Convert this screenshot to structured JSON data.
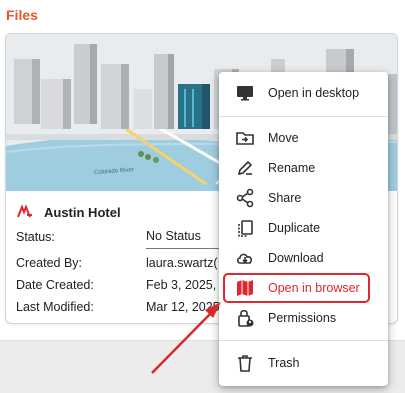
{
  "section": {
    "title": "Files"
  },
  "card": {
    "title": "Austin Hotel",
    "fields": [
      {
        "label": "Status:",
        "value": "No Status"
      },
      {
        "label": "Created By:",
        "value": "laura.swartz("
      },
      {
        "label": "Date Created:",
        "value": "Feb 3, 2025, 1"
      },
      {
        "label": "Last Modified:",
        "value": "Mar 12, 2025"
      }
    ]
  },
  "thumbnail": {
    "caption": "Colorado River"
  },
  "menu": {
    "items": [
      {
        "label": "Open in desktop",
        "icon": "monitor-icon"
      },
      {
        "label": "Move",
        "icon": "folder-move-icon"
      },
      {
        "label": "Rename",
        "icon": "pencil-icon"
      },
      {
        "label": "Share",
        "icon": "share-icon"
      },
      {
        "label": "Duplicate",
        "icon": "duplicate-icon"
      },
      {
        "label": "Download",
        "icon": "cloud-download-icon"
      },
      {
        "label": "Open in browser",
        "icon": "map-icon",
        "highlighted": true
      },
      {
        "label": "Permissions",
        "icon": "lock-person-icon"
      },
      {
        "label": "Trash",
        "icon": "trash-icon"
      }
    ]
  },
  "colors": {
    "accent": "#f0562a",
    "highlight": "#e0262f",
    "menu_icon": "#333333"
  }
}
